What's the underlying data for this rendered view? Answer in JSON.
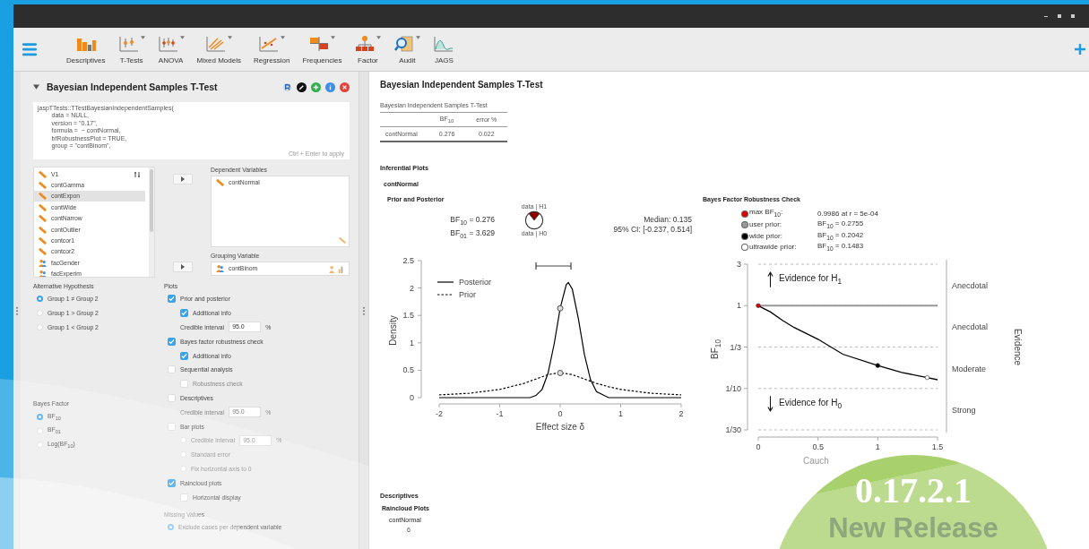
{
  "toolbar": {
    "items": [
      {
        "kind": "descriptives",
        "label": "Descriptives",
        "dropdown": false
      },
      {
        "kind": "ttest",
        "label": "T-Tests",
        "dropdown": true
      },
      {
        "kind": "anova",
        "label": "ANOVA",
        "dropdown": true
      },
      {
        "kind": "mixed",
        "label": "Mixed Models",
        "dropdown": true
      },
      {
        "kind": "regression",
        "label": "Regression",
        "dropdown": true
      },
      {
        "kind": "frequencies",
        "label": "Frequencies",
        "dropdown": true
      },
      {
        "kind": "factor",
        "label": "Factor",
        "dropdown": true
      },
      {
        "kind": "audit",
        "label": "Audit",
        "dropdown": true
      },
      {
        "kind": "jags",
        "label": "JAGS",
        "dropdown": false
      }
    ]
  },
  "analysis": {
    "title": "Bayesian Independent Samples T-Test",
    "expanded": true,
    "syntax": [
      "jaspTTests::TTestBayesianIndependentSamples(",
      "        data = NULL,",
      "        version = \"0.17\",",
      "        formula =  ~ contNormal,",
      "        bfRobustnessPlot = TRUE,",
      "        group = \"contBinom\","
    ],
    "syntax_hint": "Ctrl + Enter to apply",
    "variables": [
      {
        "name": "V1",
        "kind": "scale",
        "selected": false
      },
      {
        "name": "contGamma",
        "kind": "scale",
        "selected": false
      },
      {
        "name": "contExpon",
        "kind": "scale",
        "selected": true
      },
      {
        "name": "contWide",
        "kind": "scale",
        "selected": false
      },
      {
        "name": "contNarrow",
        "kind": "scale",
        "selected": false
      },
      {
        "name": "contOutlier",
        "kind": "scale",
        "selected": false
      },
      {
        "name": "contcor1",
        "kind": "scale",
        "selected": false
      },
      {
        "name": "contcor2",
        "kind": "scale",
        "selected": false
      },
      {
        "name": "facGender",
        "kind": "nominal",
        "selected": false
      },
      {
        "name": "facExperim",
        "kind": "nominal",
        "selected": false
      }
    ],
    "dependent": {
      "label": "Dependent Variables",
      "items": [
        {
          "name": "contNormal",
          "kind": "scale"
        }
      ]
    },
    "grouping": {
      "label": "Grouping Variable",
      "items": [
        {
          "name": "contBinom",
          "kind": "nominal"
        }
      ]
    },
    "alternative": {
      "label": "Alternative Hypothesis",
      "options": [
        {
          "label": "Group 1 ≠ Group 2",
          "selected": true
        },
        {
          "label": "Group 1 > Group 2",
          "selected": false
        },
        {
          "label": "Group 1 < Group 2",
          "selected": false
        }
      ]
    },
    "bayes_factor": {
      "label": "Bayes Factor",
      "options": [
        {
          "label": "BF$_{10}$",
          "selected": true
        },
        {
          "label": "BF$_{01}$",
          "selected": false
        },
        {
          "label": "Log(BF$_{10}$)",
          "selected": false
        }
      ]
    },
    "plots": {
      "label": "Plots",
      "options": [
        {
          "kind": "checkbox",
          "label": "Prior and posterior",
          "checked": true,
          "disabled": false,
          "children": [
            {
              "kind": "checkbox",
              "label": "Additional info",
              "checked": true,
              "disabled": false
            },
            {
              "kind": "field",
              "label": "Credible interval",
              "value": "95.0",
              "unit": "%",
              "disabled": false
            }
          ]
        },
        {
          "kind": "checkbox",
          "label": "Bayes factor robustness check",
          "checked": true,
          "disabled": false,
          "children": [
            {
              "kind": "checkbox",
              "label": "Additional info",
              "checked": true,
              "disabled": false
            }
          ]
        },
        {
          "kind": "checkbox",
          "label": "Sequential analysis",
          "checked": false,
          "disabled": false,
          "children": [
            {
              "kind": "checkbox",
              "label": "Robustness check",
              "checked": false,
              "disabled": true
            }
          ]
        },
        {
          "kind": "checkbox",
          "label": "Descriptives",
          "checked": false,
          "disabled": false,
          "children": [
            {
              "kind": "field",
              "label": "Credible interval",
              "value": "95.0",
              "unit": "%",
              "disabled": true
            }
          ]
        },
        {
          "kind": "checkbox",
          "label": "Bar plots",
          "checked": false,
          "disabled": false,
          "children": [
            {
              "kind": "radio-field",
              "label": "Credible interval",
              "value": "95.0",
              "unit": "%",
              "checked": false,
              "disabled": true
            },
            {
              "kind": "radio",
              "label": "Standard error",
              "checked": false,
              "disabled": true
            },
            {
              "kind": "radio",
              "label": "Fix horizontal axis to 0",
              "checked": false,
              "disabled": true
            }
          ]
        },
        {
          "kind": "checkbox",
          "label": "Raincloud plots",
          "checked": true,
          "disabled": false,
          "children": [
            {
              "kind": "checkbox",
              "label": "Horizontal display",
              "checked": false,
              "disabled": false
            }
          ]
        }
      ]
    },
    "missing": {
      "label": "Missing Values",
      "options": [
        {
          "label": "Exclude cases per dependent variable",
          "selected": true
        }
      ]
    }
  },
  "results": {
    "title": "Bayesian Independent Samples T-Test",
    "table": {
      "caption": "Bayesian Independent Samples T-Test",
      "columns": [
        "",
        "BF$_{10}$",
        "error %"
      ],
      "rows": [
        [
          "contNormal",
          "0.276",
          "0.022"
        ]
      ]
    },
    "section": "Inferential Plots",
    "variable": "contNormal",
    "prior_posterior": {
      "title": "Prior and Posterior",
      "bf_lines": [
        "BF$_{10}$ = 0.276",
        "BF$_{01}$ = 3.629"
      ],
      "pie_top": "data | H1",
      "pie_bottom": "data | H0",
      "stats": [
        "Median: 0.135",
        "95% CI: [-0.237, 0.514]"
      ],
      "chart_data": {
        "type": "line",
        "xlabel": "Effect size δ",
        "ylabel": "Density",
        "legend": "upper left",
        "x": [
          -2,
          -1.5,
          -1,
          -0.6,
          -0.5,
          -0.4,
          -0.3,
          -0.2,
          -0.1,
          0,
          0.1,
          0.135,
          0.2,
          0.3,
          0.4,
          0.5,
          0.6,
          0.8,
          1,
          1.5,
          2
        ],
        "series": [
          {
            "name": "Posterior",
            "color": "#000000",
            "line_style": "solid",
            "values": [
              0,
              0,
              0,
              0,
              0,
              0.04,
              0.15,
              0.45,
              0.98,
              1.63,
              2.06,
              2.1,
              1.98,
              1.44,
              0.79,
              0.33,
              0.11,
              0,
              0,
              0,
              0
            ]
          },
          {
            "name": "Prior",
            "color": "#000000",
            "line_style": "dashed",
            "values": [
              0.05,
              0.08,
              0.15,
              0.26,
              0.3,
              0.34,
              0.38,
              0.42,
              0.44,
              0.45,
              0.44,
              0.43,
              0.42,
              0.38,
              0.34,
              0.3,
              0.26,
              0.2,
              0.15,
              0.08,
              0.05
            ]
          }
        ],
        "xlim": [
          -2,
          2
        ],
        "ylim": [
          0,
          2.5
        ],
        "xticks": [
          -2,
          -1,
          0,
          1,
          2
        ],
        "yticks": [
          0,
          0.5,
          1,
          1.5,
          2,
          2.5
        ]
      }
    },
    "robustness": {
      "title": "Bayes Factor Robustness Check",
      "legend": [
        {
          "color": "#e00000",
          "label": "max BF$_{10}$:",
          "value": "0.9986 at r = 5e-04"
        },
        {
          "color": "#9a9a9a",
          "label": "user prior:",
          "value": "BF$_{10}$ = 0.2755"
        },
        {
          "color": "#000000",
          "label": "wide prior:",
          "value": "BF$_{10}$ = 0.2042"
        },
        {
          "color": "#ffffff",
          "label": "ultrawide prior:",
          "value": "BF$_{10}$ = 0.1483"
        }
      ],
      "arrows": [
        {
          "kind": "up",
          "label": "Evidence for H$_{1}$"
        },
        {
          "kind": "down",
          "label": "Evidence for H$_{0}$"
        }
      ],
      "ylabel": "BF$_{10}$",
      "side_label": "Evidence",
      "evidence_labels": [
        "Anecdotal",
        "Anecdotal",
        "Moderate",
        "Strong"
      ],
      "xlabel": "Cauch",
      "xticks": [
        "0",
        "0.5",
        "1",
        "1.5"
      ],
      "yticks": [
        "3",
        "1",
        "1/3",
        "1/10",
        "1/30"
      ]
    },
    "descriptives": {
      "title": "Descriptives",
      "subtitle": "Raincloud Plots",
      "variable": "contNormal",
      "tick": "6"
    }
  },
  "badge": {
    "version": "0.17.2.1",
    "label": "New Release"
  }
}
